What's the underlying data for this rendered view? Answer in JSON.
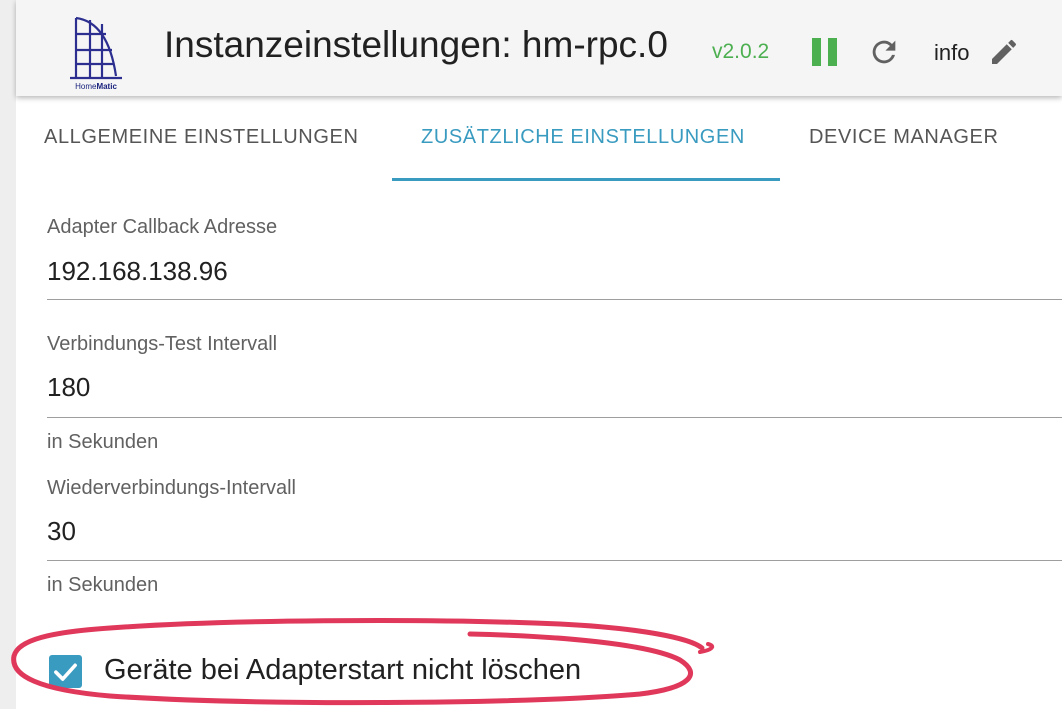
{
  "header": {
    "logo_text_regular": "Home",
    "logo_text_bold": "Matic",
    "title": "Instanzeinstellungen: hm-rpc.0",
    "version": "v2.0.2",
    "info_label": "info"
  },
  "tabs": [
    {
      "label": "ALLGEMEINE EINSTELLUNGEN",
      "active": false
    },
    {
      "label": "ZUSÄTZLICHE EINSTELLUNGEN",
      "active": true
    },
    {
      "label": "DEVICE MANAGER",
      "active": false
    }
  ],
  "fields": [
    {
      "label": "Adapter Callback Adresse",
      "value": "192.168.138.96"
    },
    {
      "label": "Verbindungs-Test Intervall",
      "value": "180",
      "helper": "in Sekunden"
    },
    {
      "label": "Wiederverbindungs-Intervall",
      "value": "30",
      "helper": "in Sekunden"
    }
  ],
  "checkbox": {
    "label": "Geräte bei Adapterstart nicht löschen",
    "checked": true
  },
  "colors": {
    "accent": "#3a9bc0",
    "status_green": "#4caf50",
    "annotation_red": "#e0385a"
  },
  "icons": [
    "homematic-logo",
    "pause-icon",
    "reload-icon",
    "edit-icon",
    "checkmark-icon"
  ]
}
